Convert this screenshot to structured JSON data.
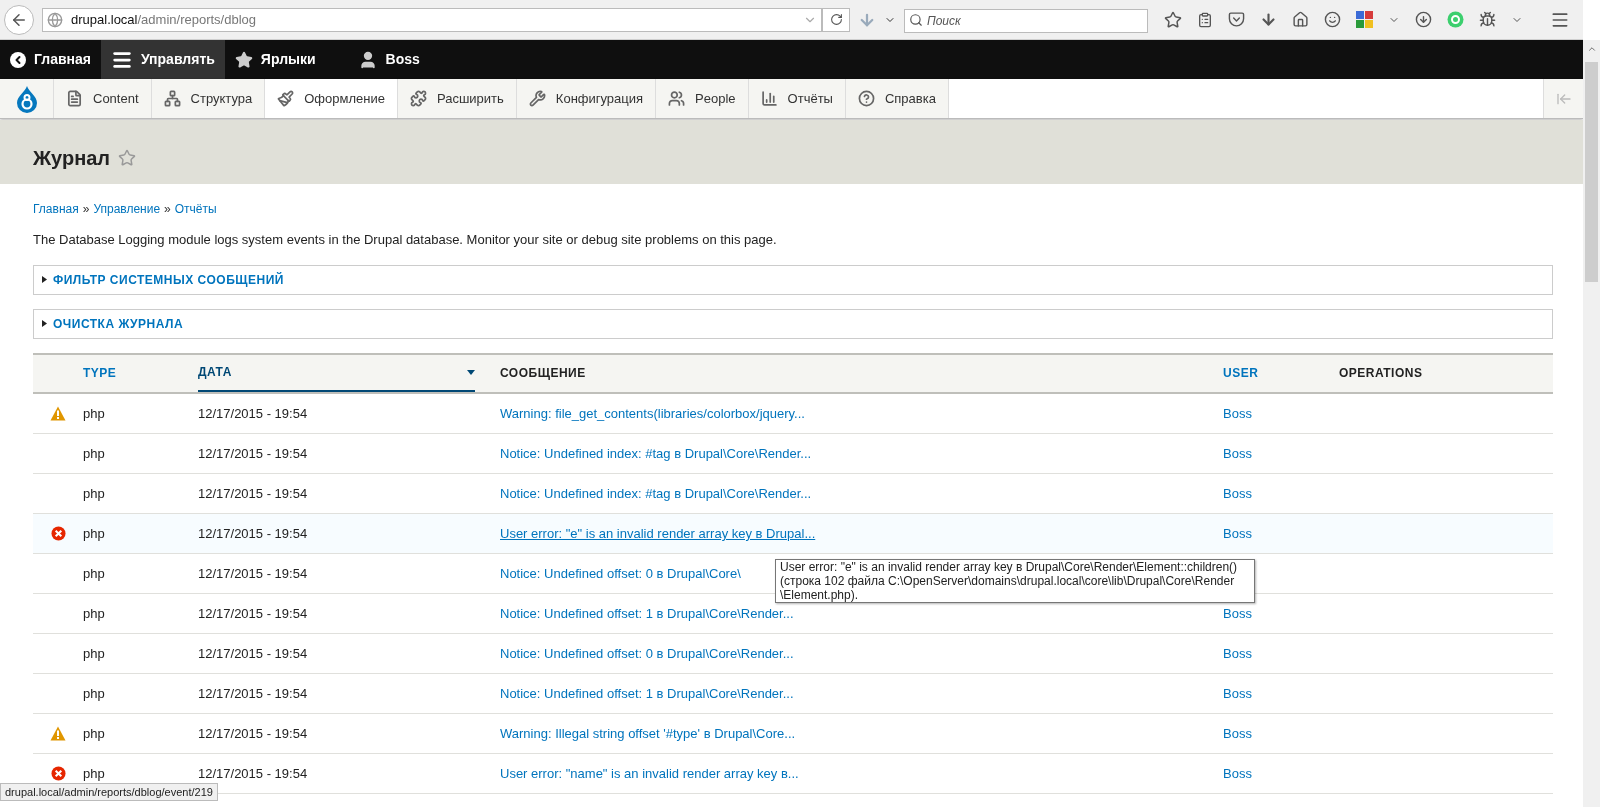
{
  "browser": {
    "url_host": "drupal.local",
    "url_path": "/admin/reports/dblog",
    "search_placeholder": "Поиск"
  },
  "toolbar": {
    "items": [
      {
        "label": "Главная",
        "selected": false
      },
      {
        "label": "Управлять",
        "selected": true
      },
      {
        "label": "Ярлыки",
        "selected": false
      },
      {
        "label": "Boss",
        "selected": false
      }
    ]
  },
  "tray": {
    "items": [
      {
        "label": "Content",
        "selected": false
      },
      {
        "label": "Структура",
        "selected": false
      },
      {
        "label": "Оформление",
        "selected": true
      },
      {
        "label": "Расширить",
        "selected": false
      },
      {
        "label": "Конфигурация",
        "selected": false
      },
      {
        "label": "People",
        "selected": false
      },
      {
        "label": "Отчёты",
        "selected": false
      },
      {
        "label": "Справка",
        "selected": false
      }
    ]
  },
  "page": {
    "title": "Журнал",
    "breadcrumb": [
      "Главная",
      "Управление",
      "Отчёты"
    ],
    "breadcrumb_separator": "»",
    "description": "The Database Logging module logs system events in the Drupal database. Monitor your site or debug site problems on this page.",
    "sections": [
      {
        "label": "ФИЛЬТР СИСТЕМНЫХ СООБЩЕНИЙ",
        "expanded": false
      },
      {
        "label": "ОЧИСТКА ЖУРНАЛА",
        "expanded": false
      }
    ]
  },
  "table": {
    "columns": [
      {
        "label": "TYPE",
        "sortable": true,
        "sorted": false
      },
      {
        "label": "ДАТА",
        "sortable": true,
        "sorted": true
      },
      {
        "label": "СООБЩЕНИЕ",
        "sortable": false,
        "sorted": false
      },
      {
        "label": "USER",
        "sortable": true,
        "sorted": false
      },
      {
        "label": "OPERATIONS",
        "sortable": false,
        "sorted": false
      }
    ],
    "rows": [
      {
        "kind": "warning",
        "type": "php",
        "date": "12/17/2015 - 19:54",
        "message": "Warning: file_get_contents(libraries/colorbox/jquery...",
        "user": "Boss",
        "hovered": false
      },
      {
        "kind": "notice",
        "type": "php",
        "date": "12/17/2015 - 19:54",
        "message": "Notice: Undefined index: #tag в Drupal\\Core\\Render...",
        "user": "Boss",
        "hovered": false
      },
      {
        "kind": "notice",
        "type": "php",
        "date": "12/17/2015 - 19:54",
        "message": "Notice: Undefined index: #tag в Drupal\\Core\\Render...",
        "user": "Boss",
        "hovered": false
      },
      {
        "kind": "error",
        "type": "php",
        "date": "12/17/2015 - 19:54",
        "message": "User error: \"e\" is an invalid render array key в Drupal...",
        "user": "Boss",
        "hovered": true
      },
      {
        "kind": "notice",
        "type": "php",
        "date": "12/17/2015 - 19:54",
        "message": "Notice: Undefined offset: 0 в Drupal\\Core\\",
        "hovered": false
      },
      {
        "kind": "notice",
        "type": "php",
        "date": "12/17/2015 - 19:54",
        "message": "Notice: Undefined offset: 1 в Drupal\\Core\\Render...",
        "user": "Boss",
        "hovered": false
      },
      {
        "kind": "notice",
        "type": "php",
        "date": "12/17/2015 - 19:54",
        "message": "Notice: Undefined offset: 0 в Drupal\\Core\\Render...",
        "user": "Boss",
        "hovered": false
      },
      {
        "kind": "notice",
        "type": "php",
        "date": "12/17/2015 - 19:54",
        "message": "Notice: Undefined offset: 1 в Drupal\\Core\\Render...",
        "user": "Boss",
        "hovered": false
      },
      {
        "kind": "warning",
        "type": "php",
        "date": "12/17/2015 - 19:54",
        "message": "Warning: Illegal string offset '#type' в Drupal\\Core...",
        "user": "Boss",
        "hovered": false
      },
      {
        "kind": "error",
        "type": "php",
        "date": "12/17/2015 - 19:54",
        "message": "User error: \"name\" is an invalid render array key в...",
        "user": "Boss",
        "hovered": false
      }
    ]
  },
  "tooltip": {
    "text": "User error: \"e\" is an invalid render array key в Drupal\\Core\\Render\\Element::children() (строка 102 файла C:\\OpenServer\\domains\\drupal.local\\core\\lib\\Drupal\\Core\\Render \\Element.php)."
  },
  "status_bar": {
    "text": "drupal.local/admin/reports/dblog/event/219"
  }
}
